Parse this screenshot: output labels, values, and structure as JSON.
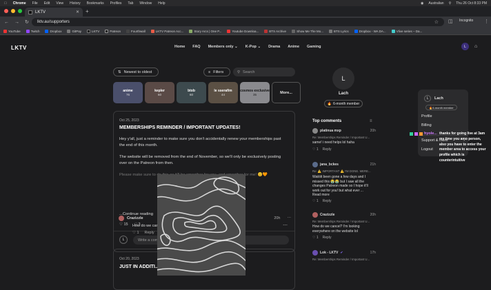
{
  "menubar": {
    "app": "Chrome",
    "items": [
      "File",
      "Edit",
      "View",
      "History",
      "Bookmarks",
      "Profiles",
      "Tab",
      "Window",
      "Help"
    ],
    "keyboard": "Australian",
    "datetime": "Thu 26 Oct 8:33 PM"
  },
  "browser": {
    "tab_title": "LKTV",
    "url": "lktv.au/supporters",
    "profile_label": "Incognito",
    "bookmarks": [
      "YouTube",
      "Twitch",
      "Dropbox",
      "GitPay",
      "LKTV",
      "Patreon",
      "Fourthwall",
      "LKTV Patreon Acc...",
      "Story Arcs | One P...",
      "Youtube Downloa...",
      "BTS Archive",
      "Show Me The Mo...",
      "BTS Lyrics",
      "Dropbox - WA DA...",
      "Vlive series – Da..."
    ]
  },
  "site": {
    "logo": "LKTV",
    "nav": [
      "Home",
      "FAQ",
      "Members only",
      "K-Pop",
      "Drama",
      "Anime",
      "Gaming"
    ],
    "user_initial": "L",
    "sort_label": "Newest to oldest",
    "filters_label": "Filters",
    "search_placeholder": "Search",
    "cards": [
      {
        "name": "anime",
        "count": "76",
        "color": "#4a4f6b"
      },
      {
        "name": "kepler",
        "count": "60",
        "color": "#5a4a46"
      },
      {
        "name": "btob",
        "count": "60",
        "color": "#3d4a4e"
      },
      {
        "name": "le sserafim",
        "count": "44",
        "color": "#5b5044"
      },
      {
        "name": "cosmos exclusive",
        "count": "35",
        "color": "#8a8a8e"
      }
    ],
    "more_label": "More...",
    "post": {
      "date": "Oct 25, 2023",
      "title": "MEMBERSHIPS REMINDER / IMPORTANT UPDATES!",
      "p1": "Hey y'all, just a reminder to make sure you don't accidentally renew your memberships past the end of this month.",
      "p2": "The website will be removed from the end of November, so we'll only be exclusively posting over on the Patreon from then.",
      "p3": "Please make sure to do this as it'll be smoother for you, and smoother for me! 😊🧡",
      "continue": "...Continue reading",
      "likes": "15",
      "comments": "3",
      "comment_placeholder": "Write a comment...",
      "reply_author": "Crazizzle",
      "reply_time": "20h",
      "reply_text": "How do we cancel? I'm looking everywhere on the website lol",
      "reply_likes": "1",
      "reply_label": "Reply"
    },
    "post2": {
      "date": "Oct 20, 2023",
      "title": "JUST IN ADDITI..."
    },
    "profile": {
      "initial": "L",
      "name": "Lach",
      "badge": "6-month member"
    },
    "top_comments": {
      "title": "Top comments",
      "items": [
        {
          "author": "platinua mxp",
          "time": "20h",
          "re": "Re: Memberships Reminder / Important U...",
          "text": "same! i need helps lol haha",
          "likes": "1",
          "reply": "Reply",
          "av": "#888"
        },
        {
          "author": "jana_bckes",
          "time": "21h",
          "re": "Re: ⚠️ IMPORTANT ⚠️ I'M DONE. MERE...",
          "text": "Waiiiiit been gone a few days and I missed this 😭😭 but I saw all the changes Patreon made so I hope it'll work out for you! but what ever ...",
          "more": "Read more",
          "likes": "1",
          "reply": "Reply",
          "av": "#5a6b8a"
        },
        {
          "author": "Crazizzle",
          "time": "20h",
          "re": "Re: Memberships Reminder / Important U...",
          "text": "How do we cancel? I'm looking everywhere on the website lol",
          "likes": "1",
          "reply": "Reply",
          "av": "#b06060"
        },
        {
          "author": "Lok - LKTV",
          "time": "17h",
          "re": "Re: Memberships Reminder / Important U...",
          "av": "#6a4fb0"
        }
      ]
    },
    "dropdown": {
      "initial": "L",
      "name": "Lach",
      "badge": "6-month member",
      "items": [
        "Profile",
        "Billing"
      ],
      "more": "Support & more",
      "logout": "Logout"
    }
  },
  "stream_chat": {
    "user": "hyole...",
    "message": "thanks for going live at 3am my time you amo person, also you have to enter the member area to access your profile which is counterintuitive"
  }
}
